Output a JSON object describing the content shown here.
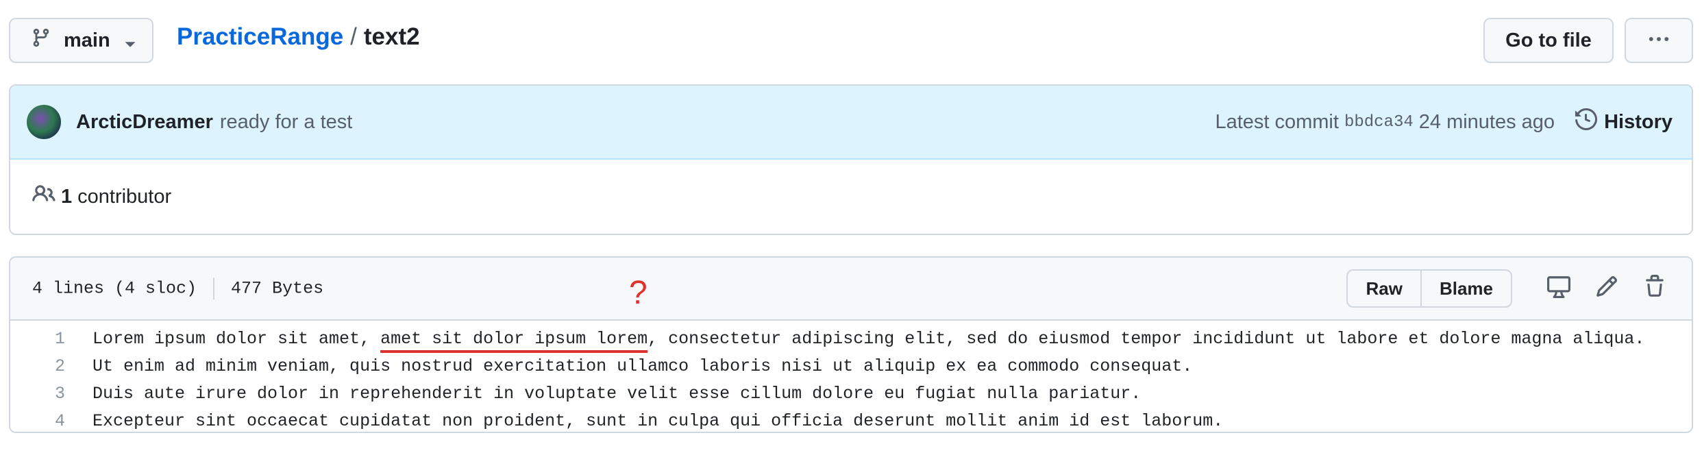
{
  "header": {
    "branch": "main",
    "repo": "PracticeRange",
    "separator": "/",
    "file": "text2",
    "goto_file": "Go to file",
    "more": "…"
  },
  "commit": {
    "author": "ArcticDreamer",
    "message": "ready for a test",
    "latest_label": "Latest commit",
    "sha": "bbdca34",
    "time": "24 minutes ago",
    "history": "History"
  },
  "contributors": {
    "count": "1",
    "label": "contributor"
  },
  "file": {
    "lines_info": "4 lines (4 sloc)",
    "size": "477 Bytes",
    "raw": "Raw",
    "blame": "Blame",
    "lines": [
      {
        "num": "1",
        "before": "Lorem ipsum dolor sit amet, ",
        "highlight": "amet sit dolor ipsum lorem",
        "after": ", consectetur adipiscing elit, sed do eiusmod tempor incididunt ut labore et dolore magna aliqua."
      },
      {
        "num": "2",
        "text": "Ut enim ad minim veniam, quis nostrud exercitation ullamco laboris nisi ut aliquip ex ea commodo consequat."
      },
      {
        "num": "3",
        "text": "Duis aute irure dolor in reprehenderit in voluptate velit esse cillum dolore eu fugiat nulla pariatur."
      },
      {
        "num": "4",
        "text": "Excepteur sint occaecat cupidatat non proident, sunt in culpa qui officia deserunt mollit anim id est laborum."
      }
    ]
  },
  "annotation": {
    "mark": "?",
    "color": "#e03131"
  },
  "colors": {
    "link": "#0969da",
    "commit_bg": "#ddf4ff",
    "border": "#d0d7de"
  }
}
